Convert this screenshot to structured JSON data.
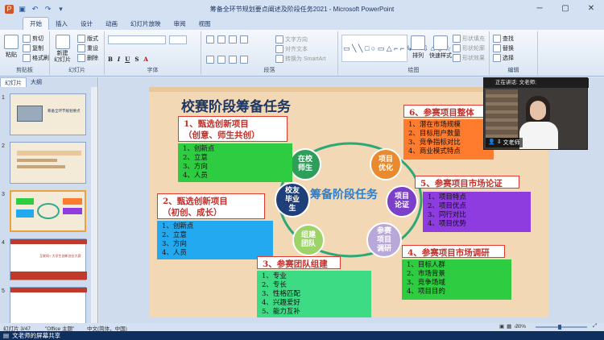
{
  "window": {
    "title": "筹备全环节规划要点阐述及阶段任务2021 - Microsoft PowerPoint"
  },
  "tabs": [
    {
      "label": "开始",
      "active": true
    },
    {
      "label": "插入"
    },
    {
      "label": "设计"
    },
    {
      "label": "动画"
    },
    {
      "label": "幻灯片放映"
    },
    {
      "label": "审阅"
    },
    {
      "label": "视图"
    }
  ],
  "ribbon": {
    "clipboard": {
      "label": "剪贴板",
      "paste": "粘贴",
      "cut": "剪切",
      "copy": "复制",
      "format_painter": "格式刷"
    },
    "slides": {
      "label": "幻灯片",
      "new_slide": "新建\n幻灯片",
      "layout": "版式",
      "reset": "重设",
      "delete": "删除"
    },
    "font": {
      "label": "字体"
    },
    "paragraph": {
      "label": "段落",
      "text_direction": "文字方向",
      "align_text": "对齐文本",
      "smartart": "转换为 SmartArt"
    },
    "drawing": {
      "label": "绘图",
      "arrange": "排列",
      "quick_styles": "快速样式",
      "shape_fill": "形状填充",
      "shape_outline": "形状轮廓",
      "shape_effects": "形状效果"
    },
    "editing": {
      "label": "编辑",
      "find": "查找",
      "replace": "替换",
      "select": "选择"
    }
  },
  "left_panel": {
    "tabs": [
      {
        "label": "幻灯片",
        "active": true
      },
      {
        "label": "大纲"
      }
    ],
    "thumb_numbers": [
      "1",
      "2",
      "3",
      "4",
      "5"
    ],
    "thumb1_text": "筹备全环节规划要点",
    "thumb4_text": "互联网+ 大学生创新创业大赛",
    "selected": 3
  },
  "slide": {
    "title": "校赛阶段筹备任务",
    "center": "筹备阶段任务",
    "sections": [
      {
        "heading": "1、甄选创新项目\n（创意、师生共创）",
        "items": [
          "1、创新点",
          "2、立意",
          "3、方向",
          "4、人员"
        ]
      },
      {
        "heading": "2、甄选创新项目\n（初创、成长）",
        "items": [
          "1、创新点",
          "2、立意",
          "3、方向",
          "4、人员"
        ]
      },
      {
        "heading": "3、参赛团队组建",
        "items": [
          "1、专业",
          "2、专长",
          "3、性格匹配",
          "4、兴趣爱好",
          "5、能力互补"
        ]
      },
      {
        "heading": "4、参赛项目市场调研",
        "items": [
          "1、目标人群",
          "2、市场背景",
          "3、竞争场域",
          "4、项目目的"
        ]
      },
      {
        "heading": "5、参赛项目市场论证",
        "items": [
          "1、项目特点",
          "2、项目优点",
          "3、同行对比",
          "4、项目优势"
        ]
      },
      {
        "heading": "6、参赛项目整体",
        "items": [
          "1、潜在市场规模",
          "2、目标用户数量",
          "3、竞争指标对比",
          "4、商业模式特点"
        ]
      }
    ],
    "circles": [
      {
        "label": "在校\n师生",
        "color": "#2e9e5b"
      },
      {
        "label": "项目\n优化",
        "color": "#e88a2d"
      },
      {
        "label": "项目\n论证",
        "color": "#7b3fc9"
      },
      {
        "label": "参赛\n项目\n调研",
        "color": "#b8a7d9"
      },
      {
        "label": "组建\n团队",
        "color": "#9ed36a"
      },
      {
        "label": "校友\n毕业\n生",
        "color": "#1f3f7a"
      }
    ]
  },
  "video": {
    "speaking": "正在讲话: 文老师;",
    "name": "文老师"
  },
  "status": {
    "slide_info": "幻灯片 3/47",
    "theme": "\"Office 主题\"",
    "lang": "中文(简体，中国)",
    "zoom": "70%"
  },
  "share_bar": {
    "text": "文老师的屏幕共享"
  },
  "colors": {
    "ribbon": "#dbe6f4",
    "slide_bg": "#f2d8b5",
    "title_blue": "#1f3763"
  }
}
